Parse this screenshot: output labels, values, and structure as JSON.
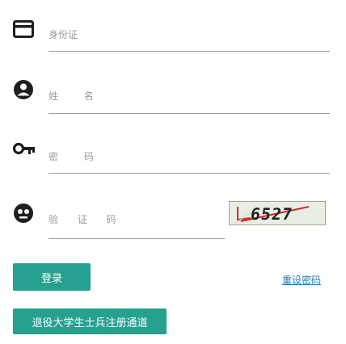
{
  "form": {
    "id_card": {
      "label": "身份证",
      "icon": "id-card-icon"
    },
    "name": {
      "label": "姓 名",
      "icon": "user-circle-icon"
    },
    "password": {
      "label": "密 码",
      "icon": "key-icon"
    },
    "captcha": {
      "label": "验 证 码",
      "icon": "shield-icon",
      "image_text": "6527"
    }
  },
  "actions": {
    "login_label": "登录",
    "reset_password_label": "重设密码",
    "veteran_register_label": "退役大学生士兵注册通道"
  },
  "colors": {
    "accent": "#26a18f",
    "link": "#2a7ab8",
    "line": "#9e9e9e"
  }
}
